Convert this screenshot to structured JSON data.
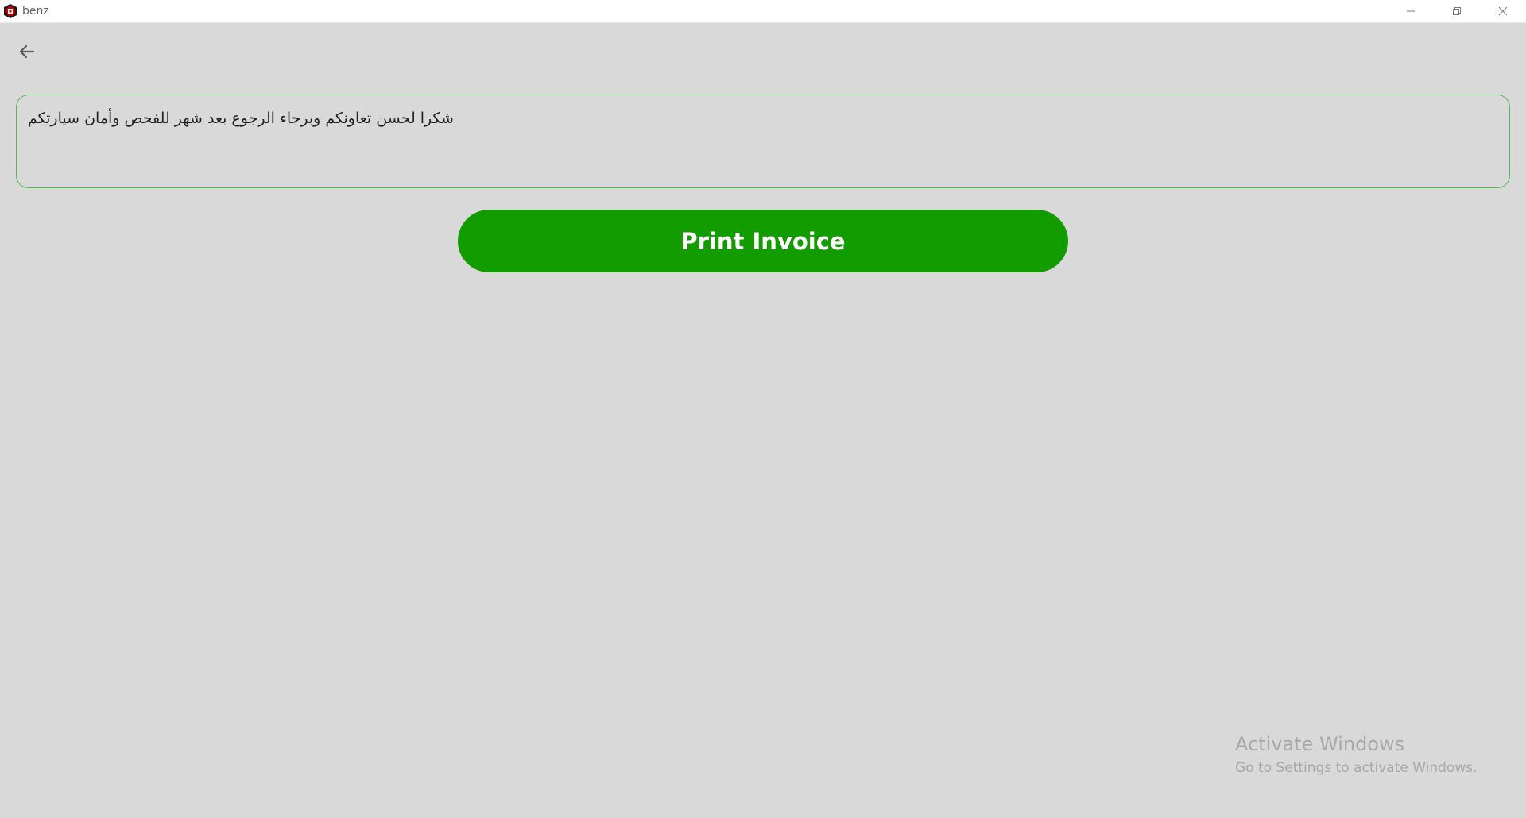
{
  "window": {
    "title": "benz",
    "logo_icon": "benz-app-icon",
    "brand_color": "#c00000"
  },
  "toolbar": {
    "back_icon": "arrow-left-icon"
  },
  "message": {
    "value": "شكرا لحسن تعاونكم وبرجاء الرجوع بعد شهر للفحص وأمان سيارتكم",
    "border_color": "#4cc24c"
  },
  "actions": {
    "print_label": "Print Invoice",
    "print_color": "#129c00"
  },
  "watermark": {
    "title": "Activate Windows",
    "subtitle": "Go to Settings to activate Windows."
  }
}
